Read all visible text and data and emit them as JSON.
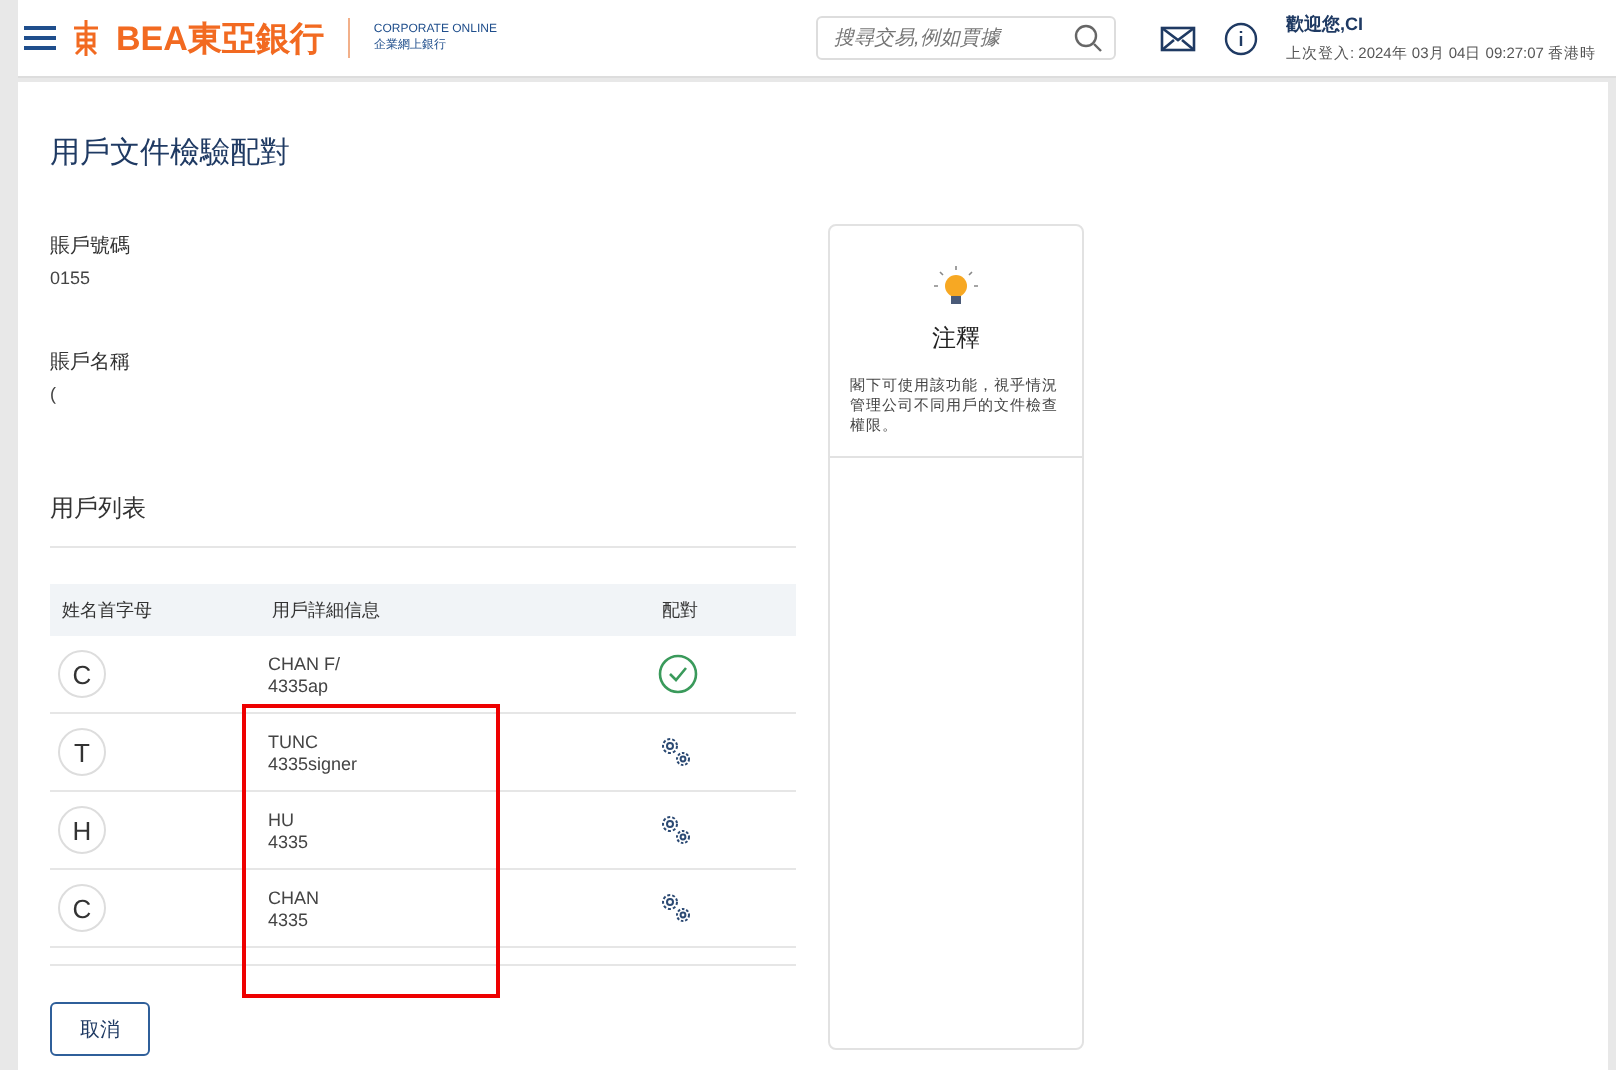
{
  "header": {
    "brand": "BEA東亞銀行",
    "product_en": "CORPORATE ONLINE",
    "product_zh": "企業網上銀行",
    "search": {
      "placeholder": "搜尋交易,例如賈據"
    },
    "welcome": "歡迎您,CI",
    "last_login": "上次登入: 2024年 03月 04日 09:27:07 香港時"
  },
  "page_title": "用戶文件檢驗配對",
  "fields": [
    {
      "label": "賬戶號碼",
      "value": "0155"
    },
    {
      "label": "賬戶名稱",
      "value": "("
    }
  ],
  "user_list": {
    "title": "用戶列表",
    "columns": [
      "姓名首字母",
      "用戶詳細信息",
      "配對"
    ],
    "rows": [
      {
        "initial": "C",
        "name": "CHAN F/",
        "id": "4335ap",
        "kind": "matched"
      },
      {
        "initial": "T",
        "name": "TUNC",
        "id": "4335signer",
        "kind": "configure"
      },
      {
        "initial": "H",
        "name": "HU",
        "id": "4335",
        "kind": "configure"
      },
      {
        "initial": "C",
        "name": "CHAN",
        "id": "4335",
        "kind": "configure"
      }
    ]
  },
  "cancel_button": "取消",
  "note": {
    "title": "注釋",
    "text": "閣下可使用該功能，視乎情況管理公司不同用戶的文件檢查權限。"
  }
}
